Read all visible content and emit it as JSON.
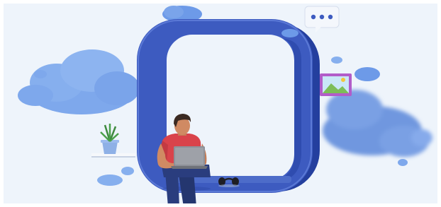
{
  "scene": {
    "subject": "person-sitting-with-laptop",
    "icons": [
      "chat-bubble-icon",
      "image-frame-icon",
      "potted-plant-icon",
      "headphones-icon"
    ],
    "colors": {
      "background": "#eef4fb",
      "frame_outer": "#3d5bc0",
      "frame_inner": "#eef4fb",
      "cloud_light": "#7ea8ec",
      "cloud_mid": "#5f8fe3",
      "shirt": "#d9434b",
      "pants": "#2a3d7e",
      "laptop": "#8e9199",
      "skin": "#d08a63",
      "hair": "#3b2a22",
      "image_frame": "#b25cc9"
    }
  }
}
